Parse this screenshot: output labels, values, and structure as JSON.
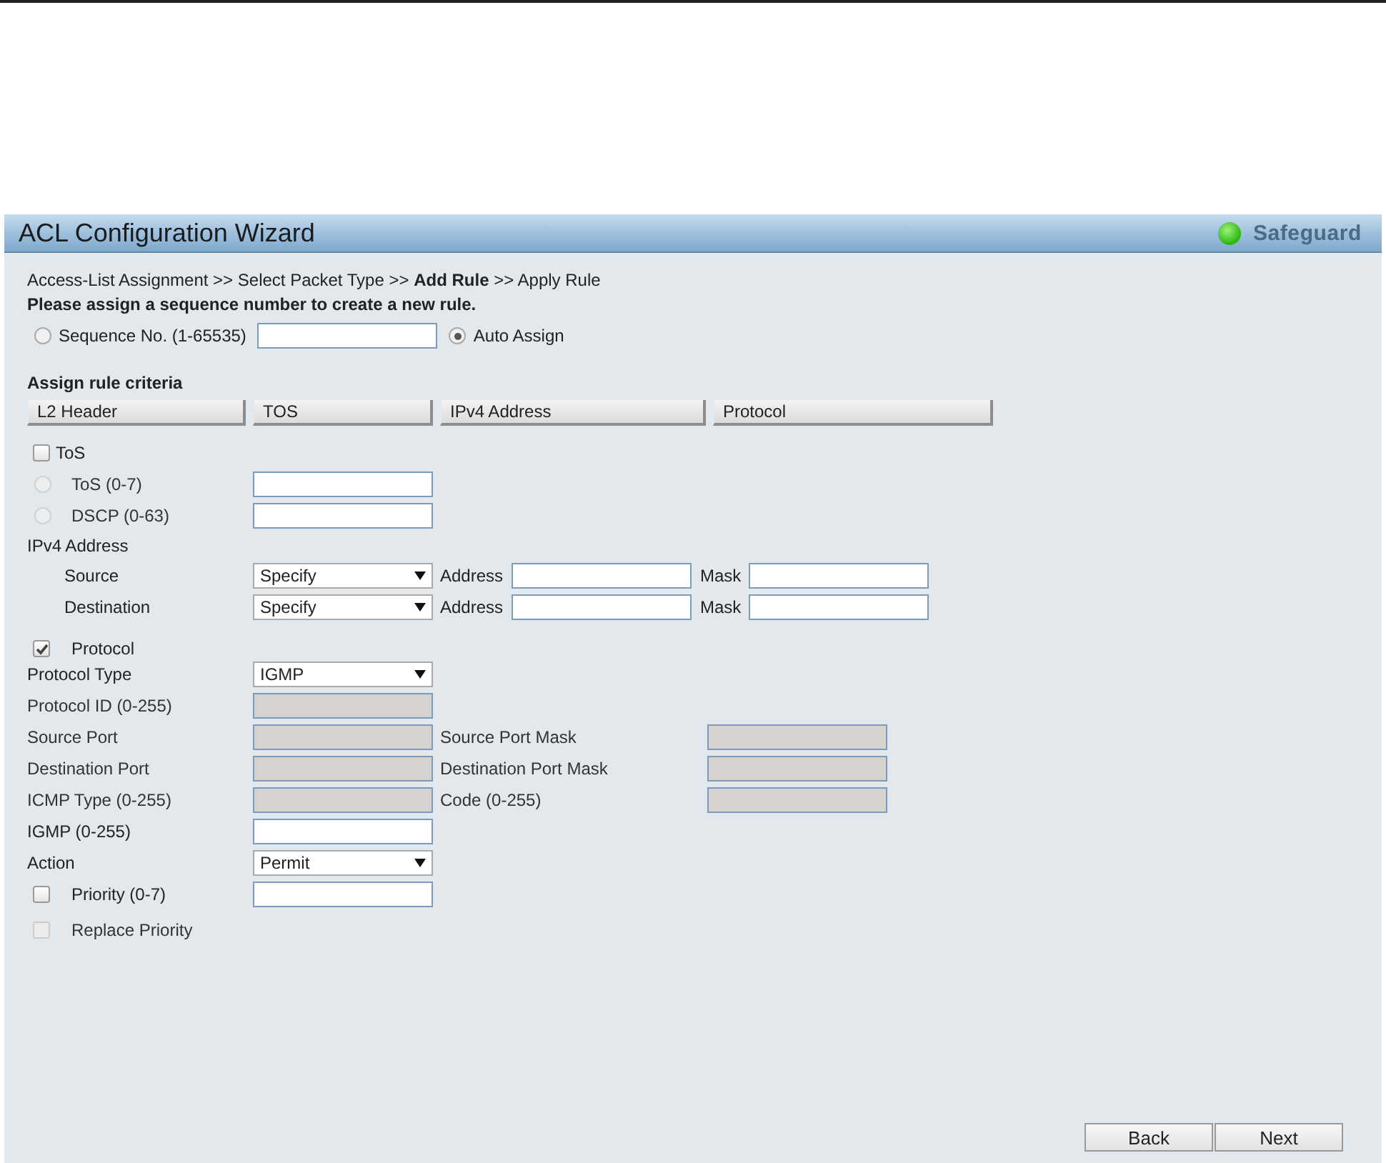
{
  "panel": {
    "title": "ACL Configuration Wizard",
    "status": "Safeguard"
  },
  "breadcrumb": "Access-List Assignment >> Select Packet Type >> **Add Rule** >> Apply Rule",
  "instruction": "Please assign a sequence number to create a new rule.",
  "sequence_options": [
    {
      "label": "Sequence No. (1-65535)",
      "selected": false,
      "has_field": true
    },
    {
      "label": "Auto Assign",
      "selected": true,
      "has_field": false
    }
  ],
  "criteria": {
    "title": "Assign rule criteria",
    "tabs": [
      {
        "label": "L2 Header"
      },
      {
        "label": "TOS"
      },
      {
        "label": "IPv4 Address"
      },
      {
        "label": "Protocol"
      }
    ]
  },
  "rows": [
    {
      "kind": "check",
      "label": "ToS",
      "checked": false,
      "disabled": false
    },
    {
      "kind": "radio",
      "label": "ToS  (0-7)",
      "selected": false,
      "disabled": true
    },
    {
      "kind": "radio",
      "label": "DSCP  (0-63)",
      "selected": false,
      "disabled": true
    },
    {
      "kind": "heading",
      "label": "IPv4 Address"
    },
    {
      "kind": "address",
      "label": "Source",
      "select": "Specify",
      "address_label": "Address",
      "mask_label": "Mask"
    },
    {
      "kind": "address",
      "label": "Destination",
      "select": "Specify",
      "address_label": "Address",
      "mask_label": "Mask"
    },
    {
      "kind": "check",
      "label": "Protocol",
      "checked": true,
      "disabled": false
    },
    {
      "kind": "select",
      "label": "Protocol Type",
      "select": "IGMP"
    },
    {
      "kind": "field",
      "label": "Protocol ID (0-255)",
      "disabled": true
    },
    {
      "kind": "pair",
      "label": "Source Port",
      "disabled": true,
      "second_label": "Source Port Mask",
      "second_disabled": true
    },
    {
      "kind": "pair",
      "label": "Destination Port",
      "disabled": true,
      "second_label": "Destination Port Mask",
      "second_disabled": true
    },
    {
      "kind": "pair",
      "label": "ICMP Type (0-255)",
      "disabled": true,
      "second_label": "Code (0-255)",
      "second_disabled": true
    },
    {
      "kind": "field",
      "label": "IGMP (0-255)",
      "disabled": false
    },
    {
      "kind": "select",
      "label": "Action",
      "select": "Permit"
    },
    {
      "kind": "check-field",
      "label": "Priority  (0-7)",
      "checked": false,
      "disabled": false
    },
    {
      "kind": "check",
      "label": "Replace Priority",
      "checked": false,
      "disabled": true
    }
  ],
  "buttons": [
    "Back",
    "Next"
  ]
}
